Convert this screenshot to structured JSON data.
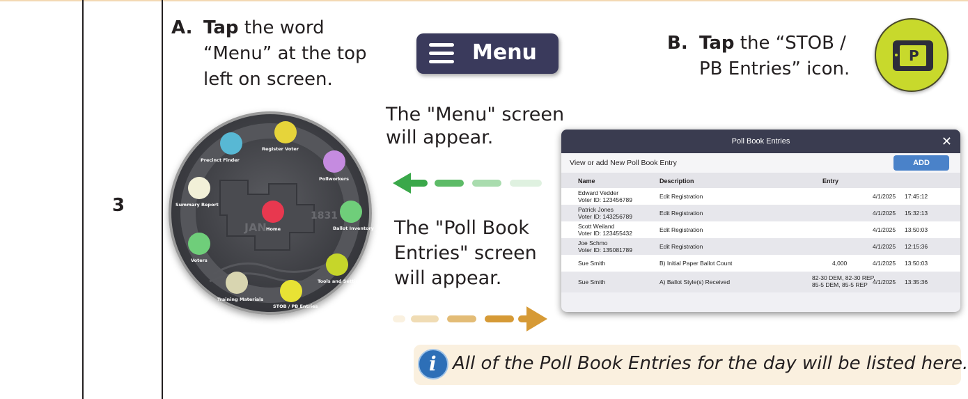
{
  "step": {
    "number": "3"
  },
  "instruction_a": {
    "letter": "A.",
    "bold": "Tap",
    "line1_rest": " the word",
    "line2": "“Menu” at the top",
    "line3": "left on screen."
  },
  "instruction_b": {
    "letter": "B.",
    "bold": "Tap",
    "line1_rest": " the “STOB /",
    "line2": "PB Entries” icon."
  },
  "menu_button": {
    "label": "Menu",
    "icon": "hamburger-icon"
  },
  "stob_icon": {
    "glyph": "P",
    "color": "#c8d92c"
  },
  "menu_screen_note": {
    "line1": "The \"Menu\" screen",
    "line2": "will appear."
  },
  "pb_screen_note": {
    "line1": "The \"Poll Book",
    "line2": "Entries\" screen",
    "line3": "will appear."
  },
  "arrows": {
    "left_color": "#3aa84a",
    "right_color": "#d69a36"
  },
  "menu_wheel": {
    "labels": {
      "register_voter": "Register Voter",
      "precinct_finder": "Precinct Finder",
      "pollworkers": "Pollworkers",
      "summary_report": "Summary Report",
      "home": "Home",
      "ballot_inventory": "Ballot Inventory",
      "voters": "Voters",
      "tools_settings": "Tools and Settings",
      "training_materials": "Training Materials",
      "stob_pb": "STOB / PB Entries"
    },
    "seal_text": "JAN 1831"
  },
  "poll_book": {
    "title": "Poll Book Entries",
    "close": "✕",
    "subtitle": "View or add New Poll Book Entry",
    "add_button": "ADD",
    "headers": {
      "name": "Name",
      "description": "Description",
      "entry": "Entry"
    },
    "rows": [
      {
        "name": "Edward Vedder",
        "voter_id": "Voter ID: 123456789",
        "description": "Edit Registration",
        "entry": "",
        "date": "4/1/2025",
        "time": "17:45:12"
      },
      {
        "name": "Patrick Jones",
        "voter_id": "Voter ID: 143256789",
        "description": "Edit Registration",
        "entry": "",
        "date": "4/1/2025",
        "time": "15:32:13"
      },
      {
        "name": "Scott Weiland",
        "voter_id": "Voter ID: 123455432",
        "description": "Edit Registration",
        "entry": "",
        "date": "4/1/2025",
        "time": "13:50:03"
      },
      {
        "name": "Joe Schmo",
        "voter_id": "Voter ID: 135081789",
        "description": "Edit Registration",
        "entry": "",
        "date": "4/1/2025",
        "time": "12:15:36"
      },
      {
        "name": "Sue Smith",
        "voter_id": "",
        "description": "B) Initial Paper Ballot Count",
        "entry": "4,000",
        "date": "4/1/2025",
        "time": "13:50:03"
      },
      {
        "name": "Sue Smith",
        "voter_id": "",
        "description": "A) Ballot Style(s) Received",
        "entry": "82-30 DEM, 82-30 REP,",
        "entry2": "85-5 DEM, 85-5 REP",
        "date": "4/1/2025",
        "time": "13:35:36"
      }
    ]
  },
  "note": {
    "icon": "info-icon",
    "text": "All of the Poll Book Entries for the day will be listed here."
  }
}
